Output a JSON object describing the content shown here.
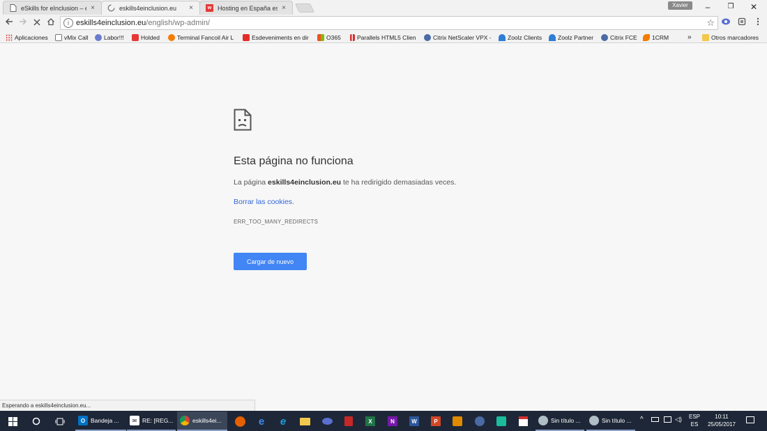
{
  "tabs": [
    {
      "title": "eSkills for eInclusion – e",
      "close": "×"
    },
    {
      "title": "eskills4einclusion.eu",
      "close": "×"
    },
    {
      "title": "Hosting en España espe",
      "close": "×"
    }
  ],
  "window": {
    "user": "Xavier",
    "minimize": "–",
    "maximize": "❐",
    "close": "✕"
  },
  "address": {
    "host": "eskills4einclusion.eu",
    "path": "/english/wp-admin/"
  },
  "bookmarks": [
    "Aplicaciones",
    "vMix Call",
    "Labor!!!",
    "Holded",
    "Terminal Fancoil Air L",
    "Esdeveniments en dir",
    "O365",
    "Parallels HTML5 Clien",
    "Citrix NetScaler VPX -",
    "Zoolz Clients",
    "Zoolz Partner",
    "Citrix FCE",
    "1CRM"
  ],
  "bookmarks_more": "»",
  "bookmarks_other": "Otros marcadores",
  "error": {
    "title": "Esta página no funciona",
    "desc_prefix": "La página ",
    "desc_host": "eskills4einclusion.eu",
    "desc_suffix": " te ha redirigido demasiadas veces.",
    "link": "Borrar las cookies.",
    "code": "ERR_TOO_MANY_REDIRECTS",
    "reload": "Cargar de nuevo"
  },
  "status": "Esperando a eskills4einclusion.eu...",
  "taskbar": {
    "apps": [
      {
        "label": "Bandeja ..."
      },
      {
        "label": "RE: [REG..."
      },
      {
        "label": "eskills4ei..."
      },
      {
        "label": "Sin título ..."
      },
      {
        "label": "Sin título ..."
      }
    ],
    "lang1": "ESP",
    "lang2": "ES",
    "time": "10:11",
    "date": "25/05/2017"
  },
  "colors": {
    "accent": "#4285f4",
    "link": "#3367d6",
    "taskbar": "#1e2737"
  }
}
